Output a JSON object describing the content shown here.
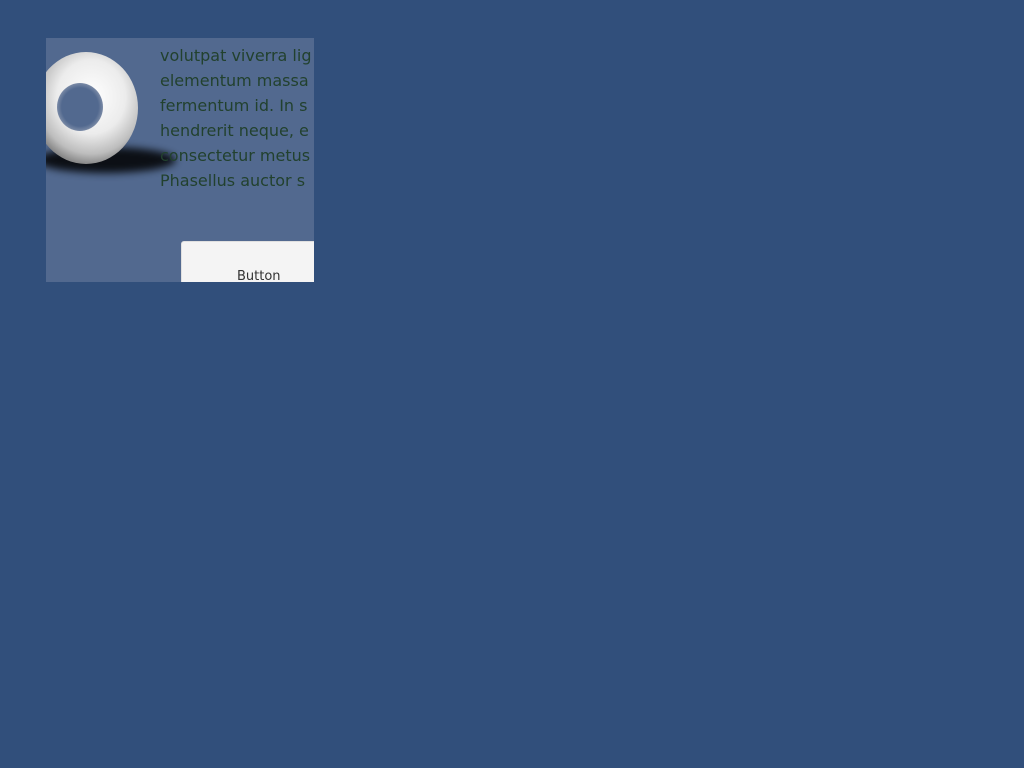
{
  "colors": {
    "desktop_background": "#314f7b",
    "panel_background": "#52698f",
    "body_text": "#22412e",
    "button_face": "#f4f4f4"
  },
  "panel": {
    "image": {
      "icon": "torus-icon"
    },
    "text_lines": [
      "volutpat viverra lig",
      "elementum massa",
      "fermentum id. In s",
      "hendrerit neque, e",
      "consectetur metus",
      "Phasellus auctor s"
    ],
    "button": {
      "label": "Button"
    }
  }
}
